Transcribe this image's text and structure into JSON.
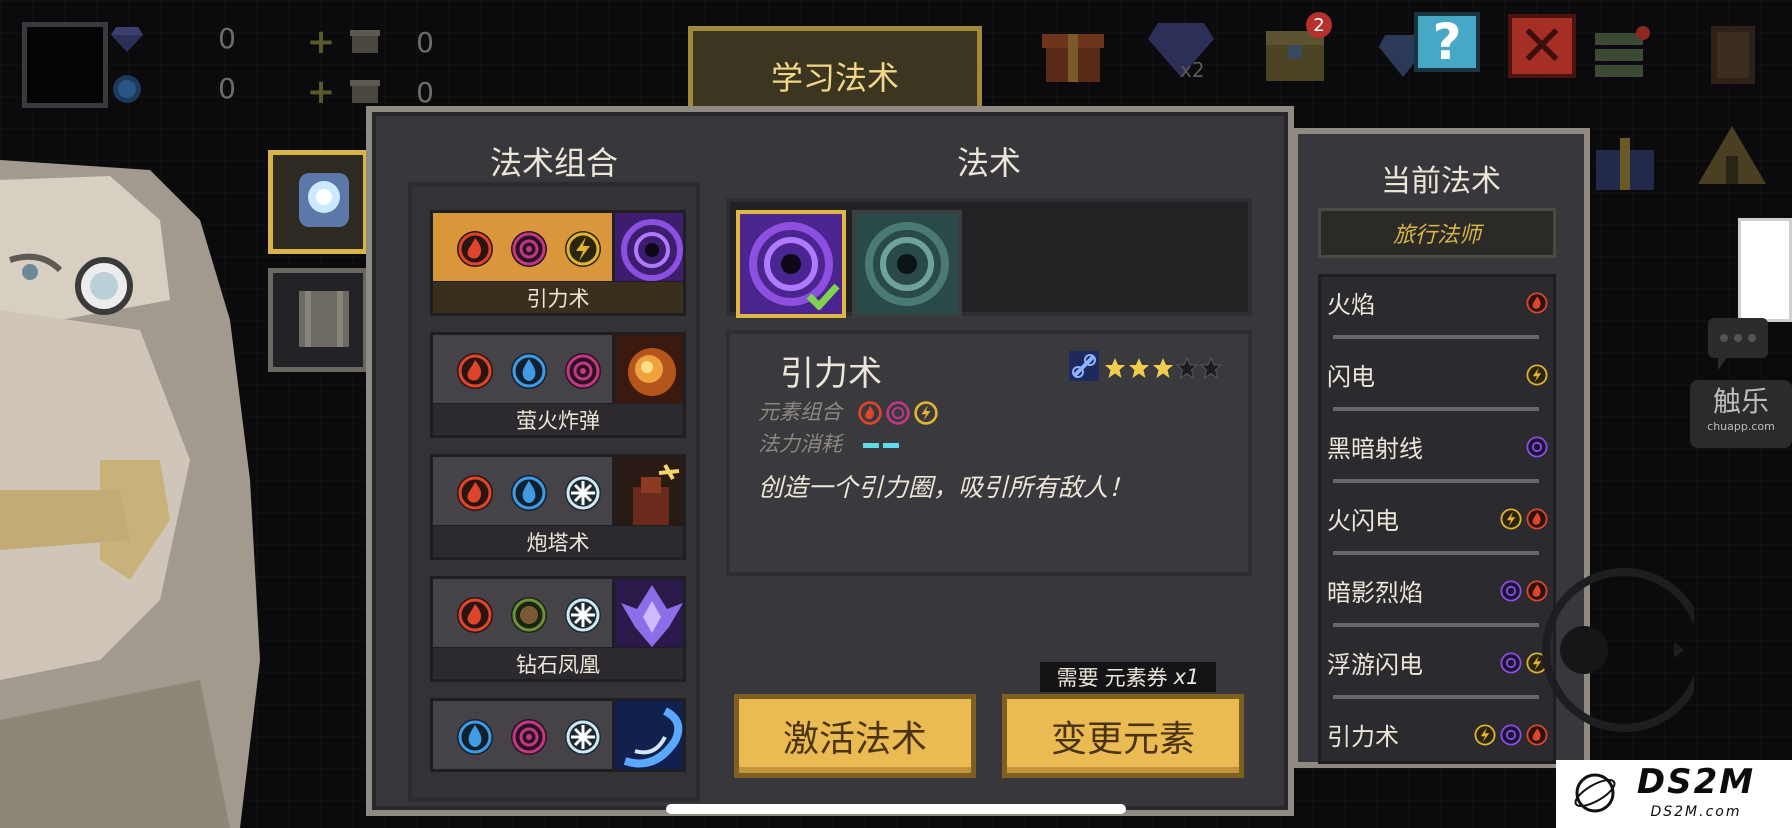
{
  "hud": {
    "resources": [
      {
        "icon": "gem-icon",
        "value": "0"
      },
      {
        "icon": "energy-coin-icon",
        "value": "0"
      }
    ],
    "scrolls": [
      {
        "icon": "scroll-icon",
        "plus": "+",
        "value": "0"
      },
      {
        "icon": "scroll-icon",
        "plus": "+",
        "value": "0"
      }
    ],
    "gift_badge": "2",
    "gem_multiplier": "x2",
    "help_label": "?",
    "close_label": "✕"
  },
  "learn_tab": {
    "label": "学习法术"
  },
  "combos": {
    "title": "法术组合",
    "items": [
      {
        "name": "引力术",
        "elements": [
          "fire",
          "dark",
          "lightning"
        ],
        "selected": true,
        "thumb": "vortex"
      },
      {
        "name": "萤火炸弹",
        "elements": [
          "fire",
          "water",
          "dark"
        ],
        "selected": false,
        "thumb": "firefly"
      },
      {
        "name": "炮塔术",
        "elements": [
          "fire",
          "water",
          "ice"
        ],
        "selected": false,
        "thumb": "turret"
      },
      {
        "name": "钻石凤凰",
        "elements": [
          "fire",
          "earth",
          "ice"
        ],
        "selected": false,
        "thumb": "phoenix"
      },
      {
        "name": "",
        "elements": [
          "water",
          "dark",
          "ice"
        ],
        "selected": false,
        "thumb": "swirl"
      }
    ]
  },
  "spells": {
    "title": "法术",
    "variants": [
      {
        "thumb": "vortex-purple",
        "selected": true
      },
      {
        "thumb": "vortex-teal",
        "selected": false
      }
    ]
  },
  "detail": {
    "name": "引力术",
    "stars": 3,
    "max_stars": 5,
    "element_label": "元素组合",
    "elements": [
      "fire",
      "dark",
      "lightning"
    ],
    "mana_label": "法力消耗",
    "mana_bars": 2,
    "description": "创造一个引力圈，吸引所有敌人！"
  },
  "requirement": {
    "prefix": "需要",
    "item": "元素券",
    "count": "x1"
  },
  "buttons": {
    "activate": "激活法术",
    "change": "变更元素"
  },
  "current": {
    "title": "当前法术",
    "class_name": "旅行法师",
    "spells": [
      {
        "name": "火焰",
        "elements": [
          "fire"
        ]
      },
      {
        "name": "闪电",
        "elements": [
          "lightning"
        ]
      },
      {
        "name": "黑暗射线",
        "elements": [
          "dark"
        ]
      },
      {
        "name": "火闪电",
        "elements": [
          "lightning",
          "fire"
        ]
      },
      {
        "name": "暗影烈焰",
        "elements": [
          "dark",
          "fire"
        ]
      },
      {
        "name": "浮游闪电",
        "elements": [
          "dark",
          "lightning"
        ]
      },
      {
        "name": "引力术",
        "elements": [
          "lightning",
          "dark",
          "fire"
        ]
      }
    ]
  },
  "watermarks": {
    "chuapp_big": "触乐",
    "chuapp_small": "chuapp.com",
    "ds2m_big": "DS2M",
    "ds2m_small": "DS2M.com"
  },
  "colors": {
    "fire": "#e0452c",
    "water": "#3f9be3",
    "dark": "#c23884",
    "lightning": "#e2b52d",
    "ice": "#cfe8f5",
    "earth": "#6f8f3a",
    "accent_gold": "#e9bb52",
    "violet": "#8c4fe0"
  }
}
